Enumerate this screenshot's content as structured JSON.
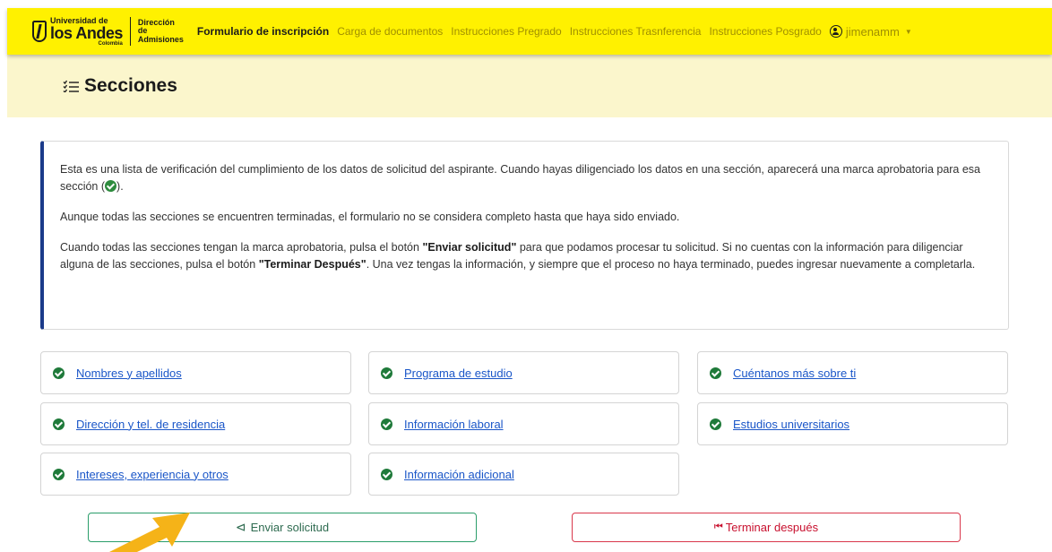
{
  "header": {
    "logo_university": "Universidad de",
    "logo_name": "los Andes",
    "logo_country": "Colombia",
    "logo_department": "Dirección de Admisiones",
    "nav": [
      {
        "label": "Formulario de inscripción",
        "active": true
      },
      {
        "label": "Carga de documentos",
        "active": false
      },
      {
        "label": "Instrucciones Pregrado",
        "active": false
      },
      {
        "label": "Instrucciones Trasnferencia",
        "active": false
      },
      {
        "label": "Instrucciones Posgrado",
        "active": false
      }
    ],
    "user": "jimenamm",
    "brand_color": "#fff100"
  },
  "page": {
    "title": "Secciones"
  },
  "info": {
    "p1_before": "Esta es una lista de verificación del cumplimiento de los datos de solicitud del aspirante. Cuando hayas diligenciado los datos en una sección, aparecerá una marca aprobatoria para esa sección (",
    "p1_after": ").",
    "p2": "Aunque todas las secciones se encuentren terminadas, el formulario no se considera completo hasta que haya sido enviado.",
    "p3_a": "Cuando todas las secciones tengan la marca aprobatoria, pulsa el botón ",
    "p3_b": "\"Enviar solicitud\"",
    "p3_c": " para que podamos procesar tu solicitud. Si no cuentas con la información para diligenciar alguna de las secciones, pulsa el botón ",
    "p3_d": "\"Terminar Después\"",
    "p3_e": ". Una vez tengas la información, y siempre que el proceso no haya terminado, puedes ingresar nuevamente a completarla."
  },
  "sections": [
    {
      "label": "Nombres y apellidos",
      "complete": true
    },
    {
      "label": "Programa de estudio",
      "complete": true
    },
    {
      "label": "Cuéntanos más sobre ti",
      "complete": true
    },
    {
      "label": "Dirección y tel. de residencia",
      "complete": true
    },
    {
      "label": "Información laboral",
      "complete": true
    },
    {
      "label": "Estudios universitarios",
      "complete": true
    },
    {
      "label": "Intereses, experiencia y otros",
      "complete": true
    },
    {
      "label": "Información adicional",
      "complete": true
    }
  ],
  "actions": {
    "send_label": "Enviar solicitud",
    "later_label": "Terminar después",
    "send_color": "#2a9d6a",
    "later_color": "#d9374b"
  },
  "annotation": {
    "arrow_color": "#f5b318"
  }
}
